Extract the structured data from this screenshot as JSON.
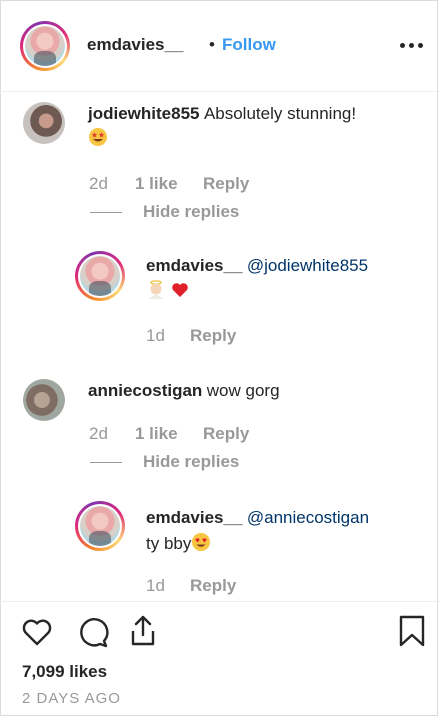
{
  "post": {
    "author": "emdavies__",
    "separator": "•",
    "follow_label": "Follow",
    "likes": "7,099 likes",
    "age": "2 DAYS AGO"
  },
  "comments": [
    {
      "user": "jodiewhite855",
      "text": "Absolutely stunning!",
      "time": "2d",
      "likes": "1 like",
      "reply_label": "Reply",
      "hide_replies": "Hide replies",
      "reply": {
        "user": "emdavies__",
        "mention": "@jodiewhite855",
        "text": "",
        "time": "1d",
        "reply_label": "Reply"
      }
    },
    {
      "user": "anniecostigan",
      "text": "wow gorg",
      "time": "2d",
      "likes": "1 like",
      "reply_label": "Reply",
      "hide_replies": "Hide replies",
      "reply": {
        "user": "emdavies__",
        "mention": "@anniecostigan",
        "text": "ty bby",
        "time": "1d",
        "reply_label": "Reply"
      }
    }
  ],
  "icons": {
    "like": "heart-icon",
    "comment": "comment-icon",
    "share": "share-icon",
    "save": "bookmark-icon",
    "more": "more-options-icon"
  },
  "colors": {
    "link": "#3897f0",
    "mention": "#003569",
    "muted": "#999999",
    "text": "#262626"
  }
}
